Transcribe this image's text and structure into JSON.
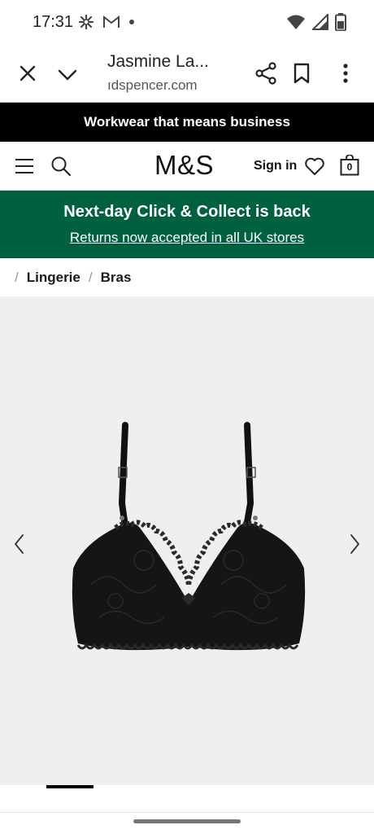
{
  "status_bar": {
    "time": "17:31",
    "icons": [
      "settings-icon",
      "gmail-icon",
      "notification-dot-icon",
      "wifi-icon",
      "signal-icon",
      "battery-icon"
    ]
  },
  "browser": {
    "title": "Jasmine La...",
    "url": "ıdspencer.com",
    "icons": [
      "close-icon",
      "chevron-down-icon",
      "share-icon",
      "bookmark-icon",
      "more-vert-icon"
    ]
  },
  "promo_strip": {
    "text": "Workwear that means business"
  },
  "header": {
    "logo": "M&S",
    "sign_in": "Sign in",
    "bag_count": "0",
    "icons": [
      "menu-icon",
      "search-icon",
      "heart-icon",
      "bag-icon"
    ]
  },
  "banner": {
    "title": "Next-day Click & Collect is back",
    "subtitle": "Returns now accepted in all UK stores",
    "background": "#006140"
  },
  "breadcrumb": {
    "items": [
      "Lingerie",
      "Bras"
    ]
  },
  "gallery": {
    "background": "#efefee",
    "icons": [
      "chevron-left-icon",
      "chevron-right-icon"
    ],
    "image": "black-lace-bra-image"
  },
  "colors": {
    "brand_green": "#006140",
    "strip_black": "#000000"
  }
}
